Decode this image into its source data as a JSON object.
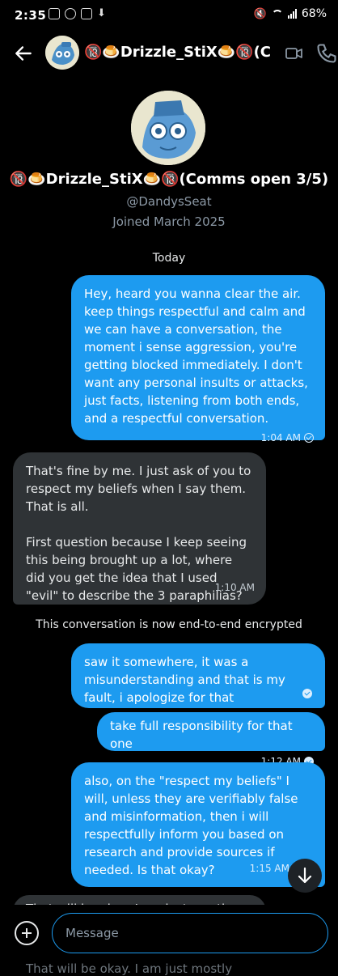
{
  "status_bar": {
    "time": "2:35",
    "battery": "68%"
  },
  "header": {
    "title": "🔞🍮Drizzle_StiX🍮🔞(C..."
  },
  "profile": {
    "name": "🔞🍮Drizzle_StiX🍮🔞(Comms open 3/5)",
    "handle": "@DandysSeat",
    "joined": "Joined March 2025"
  },
  "conversation": {
    "date_divider": "Today",
    "system_notice": "This conversation is now end-to-end encrypted",
    "messages": [
      {
        "direction": "out",
        "text": "Hey, heard you wanna clear the air. keep things respectful and calm and we can have a conversation, the moment i sense aggression, you're getting blocked immediately. I don't want any personal insults or attacks, just facts, listening from both ends, and a respectful conversation.",
        "time": "1:04 AM"
      },
      {
        "direction": "in",
        "text": "That's fine by me. I just ask of you to respect my beliefs when I say them. That is all.\n\nFirst question because I keep seeing this being brought up a lot, where did you get the idea that I used \"evil\" to describe the 3 paraphilias?",
        "time": "1:10 AM"
      },
      {
        "direction": "out",
        "text": "saw it somewhere, it was a misunderstanding and that is my fault, i apologize for that",
        "time": ""
      },
      {
        "direction": "out",
        "text": "take full responsibility for that one",
        "time": "1:12 AM"
      },
      {
        "direction": "out",
        "text": "also, on the \"respect my beliefs\" I will, unless they are verifiably false and misinformation, then i will respectfully inform you based on research and provide sources if needed. Is that okay?",
        "time": "1:15 AM"
      },
      {
        "direction": "in",
        "text": "That will be okay. I am just mostly",
        "time": ""
      }
    ]
  },
  "composer": {
    "placeholder": "Message",
    "ghost_text": "That will be okay. I am just mostly"
  },
  "colors": {
    "accent": "#1d9bf0",
    "incoming_bubble": "#2f3336",
    "background": "#000000"
  },
  "icons": [
    "back-arrow-icon",
    "video-icon",
    "phone-icon",
    "plus-circle-icon",
    "arrow-down-icon",
    "read-check-icon"
  ]
}
